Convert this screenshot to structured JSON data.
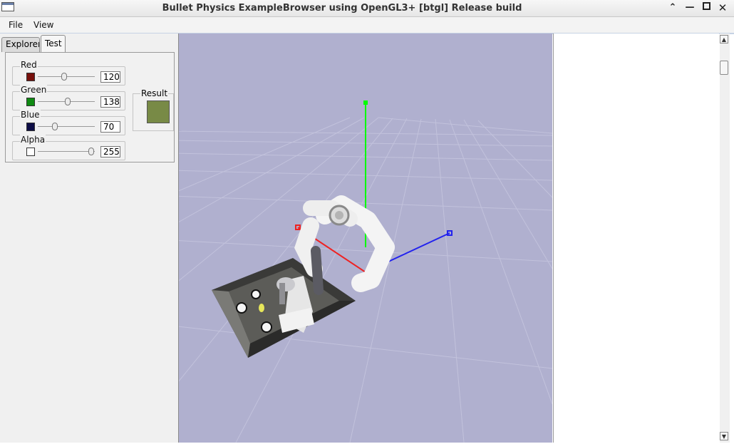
{
  "window": {
    "title": "Bullet Physics ExampleBrowser using OpenGL3+ [btgl] Release build"
  },
  "menu": {
    "file": "File",
    "view": "View"
  },
  "tabs": [
    {
      "label": "Explorer",
      "active": false
    },
    {
      "label": "Test",
      "active": true
    }
  ],
  "color_controls": [
    {
      "label": "Red",
      "value": "120",
      "swatch_color": "#78100c",
      "slider_fraction": 0.47
    },
    {
      "label": "Green",
      "value": "138",
      "swatch_color": "#0f8a12",
      "slider_fraction": 0.54
    },
    {
      "label": "Blue",
      "value": "70",
      "swatch_color": "#0d0d46",
      "slider_fraction": 0.27
    },
    {
      "label": "Alpha",
      "value": "255",
      "swatch_color": "#ffffff",
      "slider_fraction": 1.0
    }
  ],
  "result": {
    "label": "Result",
    "color": "#788a46"
  }
}
